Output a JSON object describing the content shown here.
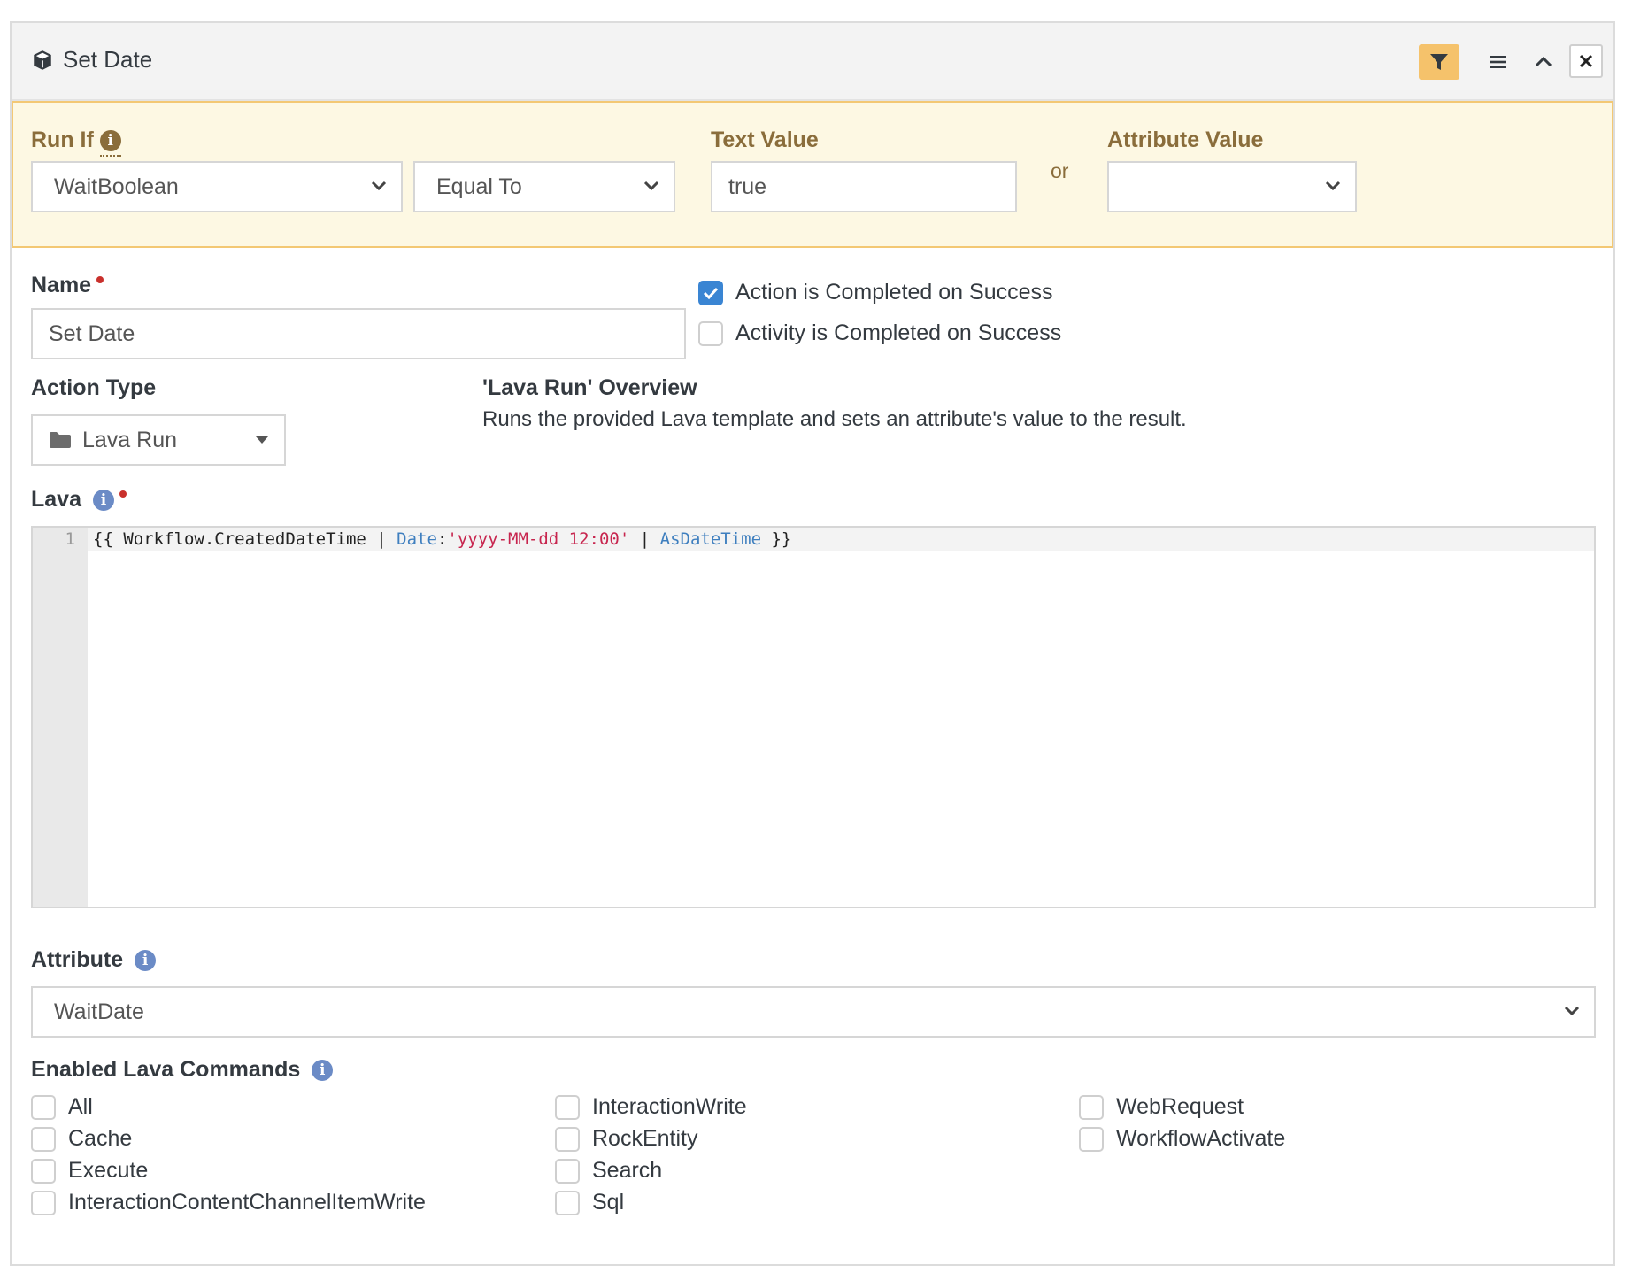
{
  "header": {
    "title": "Set Date",
    "title_icon": "cube-icon",
    "buttons": [
      "filter-icon",
      "bars-icon",
      "chevron-up-icon",
      "close-icon"
    ]
  },
  "run_if": {
    "label": "Run If",
    "attribute_select": "WaitBoolean",
    "comparison_select": "Equal To",
    "text_value_label": "Text Value",
    "text_value": "true",
    "or_label": "or",
    "attribute_value_label": "Attribute Value",
    "attribute_value": ""
  },
  "name": {
    "label": "Name",
    "value": "Set Date"
  },
  "completion": {
    "action_completed_label": "Action is Completed on Success",
    "action_completed_checked": true,
    "activity_completed_label": "Activity is Completed on Success",
    "activity_completed_checked": false
  },
  "action_type": {
    "label": "Action Type",
    "value": "Lava Run",
    "icon": "folder-icon"
  },
  "overview": {
    "title": "'Lava Run' Overview",
    "description": "Runs the provided Lava template and sets an attribute's value to the result."
  },
  "lava": {
    "label": "Lava",
    "line_number": "1",
    "code": {
      "t1": "{{ Workflow.CreatedDateTime | ",
      "t2": "Date",
      "t3": ":",
      "t4": "'yyyy-MM-dd 12:00'",
      "t5": " | ",
      "t6": "AsDateTime",
      "t7": " }}"
    }
  },
  "attribute": {
    "label": "Attribute",
    "value": "WaitDate"
  },
  "commands": {
    "label": "Enabled Lava Commands",
    "col1": [
      "All",
      "Cache",
      "Execute",
      "InteractionContentChannelItemWrite"
    ],
    "col2": [
      "InteractionWrite",
      "RockEntity",
      "Search",
      "Sql"
    ],
    "col3": [
      "WebRequest",
      "WorkflowActivate"
    ]
  },
  "colors": {
    "accent": "#3a85d3",
    "warning_bg": "#fdf8e3",
    "warning_text": "#8a6d3b",
    "filter_button": "#f5c26b"
  }
}
